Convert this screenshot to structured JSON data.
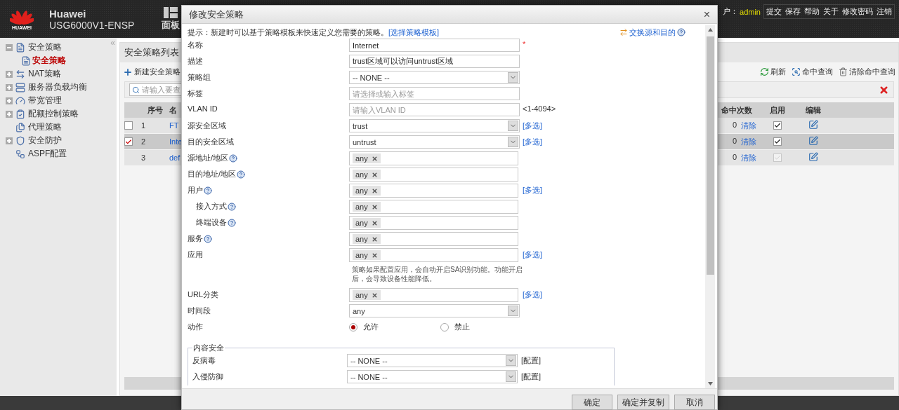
{
  "header": {
    "brand": "HUAWEI",
    "title": "Huawei",
    "model": "USG6000V1-ENSP",
    "panel_label": "面板",
    "user_label": "户：",
    "user": "admin",
    "actions": [
      "提交",
      "保存",
      "帮助",
      "关于",
      "修改密码",
      "注销"
    ]
  },
  "sidebar": {
    "collapse": "«",
    "items": [
      {
        "label": "安全策略",
        "kind": "group",
        "expanded": true,
        "children": [
          {
            "label": "安全策略",
            "selected": true
          }
        ]
      },
      {
        "label": "NAT策略",
        "kind": "group",
        "expanded": false
      },
      {
        "label": "服务器负载均衡",
        "kind": "group",
        "expanded": false
      },
      {
        "label": "带宽管理",
        "kind": "group",
        "expanded": false
      },
      {
        "label": "配额控制策略",
        "kind": "group",
        "expanded": false
      },
      {
        "label": "代理策略",
        "kind": "leaf"
      },
      {
        "label": "安全防护",
        "kind": "group",
        "expanded": false
      },
      {
        "label": "ASPF配置",
        "kind": "leaf"
      }
    ]
  },
  "list": {
    "title": "安全策略列表",
    "new_button": "新建安全策略",
    "tools": [
      "刷新",
      "命中查询",
      "清除命中查询"
    ],
    "search_placeholder": "请输入要查",
    "columns": [
      "序号",
      "名",
      "命中次数",
      "启用",
      "编辑"
    ],
    "rows": [
      {
        "kind": "policy",
        "checked": false,
        "selected": false,
        "index": "1",
        "name": "FT",
        "hits": "0",
        "clear": "清除",
        "enabled": true,
        "disabled": false
      },
      {
        "kind": "policy",
        "checked": true,
        "selected": true,
        "index": "2",
        "name": "Inte",
        "hits": "0",
        "clear": "清除",
        "enabled": true,
        "disabled": false
      },
      {
        "kind": "default",
        "selected": false,
        "index": "3",
        "name": "def",
        "hits": "0",
        "clear": "清除",
        "enabled": true,
        "disabled": true
      }
    ]
  },
  "dialog": {
    "title": "修改安全策略",
    "close": "×",
    "hint": "提示：新建时可以基于策略模板来快速定义您需要的策略。",
    "hint_link": "[选择策略模板]",
    "swap_link": "交换源和目的",
    "fields": [
      {
        "kind": "text",
        "label": "名称",
        "value": "Internet",
        "required_mark": "*",
        "help": false
      },
      {
        "kind": "text",
        "label": "描述",
        "value": "trust区域可以访问untrust区域",
        "help": false
      },
      {
        "kind": "select",
        "label": "策略组",
        "value": "-- NONE --",
        "help": false
      },
      {
        "kind": "text",
        "label": "标签",
        "placeholder": "请选择或输入标签",
        "help": false
      },
      {
        "kind": "text",
        "label": "VLAN ID",
        "placeholder": "请输入VLAN ID",
        "suffix": "<1-4094>",
        "help": false
      },
      {
        "kind": "select",
        "label": "源安全区域",
        "value": "trust",
        "link": "[多选]",
        "help": false
      },
      {
        "kind": "select",
        "label": "目的安全区域",
        "value": "untrust",
        "link": "[多选]",
        "help": false
      },
      {
        "kind": "tags",
        "label": "源地址/地区",
        "tags": [
          "any"
        ],
        "help": true
      },
      {
        "kind": "tags",
        "label": "目的地址/地区",
        "tags": [
          "any"
        ],
        "help": true
      },
      {
        "kind": "tags",
        "label": "用户",
        "tags": [
          "any"
        ],
        "link": "[多选]",
        "help": true,
        "children": [
          {
            "kind": "tags",
            "label": "接入方式",
            "tags": [
              "any"
            ],
            "help": true
          },
          {
            "kind": "tags",
            "label": "终端设备",
            "tags": [
              "any"
            ],
            "help": true
          }
        ]
      },
      {
        "kind": "tags",
        "label": "服务",
        "tags": [
          "any"
        ],
        "help": true
      },
      {
        "kind": "tags",
        "label": "应用",
        "tags": [
          "any"
        ],
        "link": "[多选]",
        "help": false,
        "note": "策略如果配置应用，会自动开启SA识别功能。功能开启后，会导致设备性能降低。"
      },
      {
        "kind": "tags",
        "label": "URL分类",
        "tags": [
          "any"
        ],
        "link": "[多选]",
        "help": false
      },
      {
        "kind": "select",
        "label": "时间段",
        "value": "any",
        "help": false
      },
      {
        "kind": "radio",
        "label": "动作",
        "help": false,
        "options": [
          {
            "label": "允许",
            "selected": true
          },
          {
            "label": "禁止",
            "selected": false
          }
        ]
      }
    ],
    "content_security": {
      "legend": "内容安全",
      "fields": [
        {
          "label": "反病毒",
          "value": "-- NONE --",
          "link": "[配置]"
        },
        {
          "label": "入侵防御",
          "value": "-- NONE --",
          "link": "[配置]"
        }
      ]
    },
    "buttons": [
      "确定",
      "确定并复制",
      "取消"
    ]
  }
}
